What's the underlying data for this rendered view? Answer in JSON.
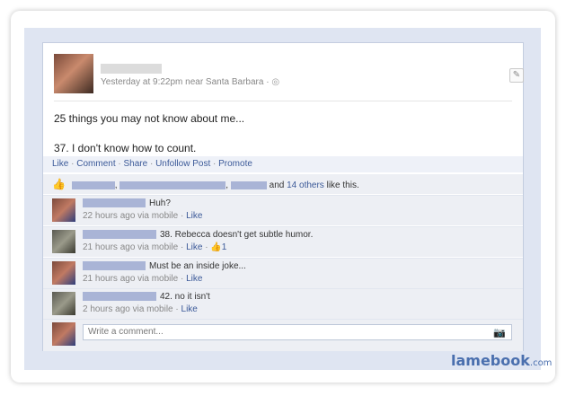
{
  "post": {
    "meta": "Yesterday at 9:22pm near Santa Barbara",
    "meta_sep": " · ",
    "globe_icon": "globe-icon",
    "line1": "25 things you may not know about me...",
    "line2": "37. I don't know how to count."
  },
  "actions": {
    "like": "Like",
    "comment": "Comment",
    "share": "Share",
    "unfollow": "Unfollow Post",
    "promote": "Promote",
    "sep": " · "
  },
  "likes": {
    "and_text": "and",
    "others_link": "14 others",
    "suffix": "like this.",
    "comma": ","
  },
  "comments": [
    {
      "text": "Huh?",
      "time": "22 hours ago via mobile",
      "like": "Like",
      "like_count": ""
    },
    {
      "text": "38. Rebecca doesn't get subtle humor.",
      "time": "21 hours ago via mobile",
      "like": "Like",
      "like_count": "1"
    },
    {
      "text": "Must be an inside joke...",
      "time": "21 hours ago via mobile",
      "like": "Like",
      "like_count": ""
    },
    {
      "text": "42. no it isn't",
      "time": "2 hours ago via mobile",
      "like": "Like",
      "like_count": ""
    }
  ],
  "write": {
    "placeholder": "Write a comment..."
  },
  "watermark": {
    "brand": "lamebook",
    "tld": ".com"
  },
  "colors": {
    "link": "#3b5998",
    "accent_bg": "#edeff4",
    "redaction": "#a9b4d6"
  }
}
